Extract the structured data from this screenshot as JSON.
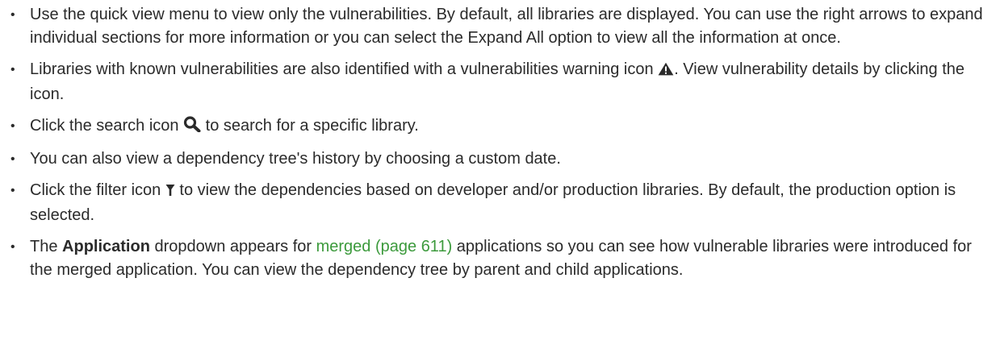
{
  "items": [
    {
      "text": "Use the quick view menu to view only the vulnerabilities. By default, all libraries are displayed. You can use the right arrows to expand individual sections for more information or you can select the Expand All option to view all the information at once."
    },
    {
      "before_icon": "Libraries with known vulnerabilities are also identified with a vulnerabilities warning icon ",
      "icon": "warning-triangle-icon",
      "after_icon": ". View vulnerability details by clicking the icon."
    },
    {
      "before_icon": "Click the search icon ",
      "icon": "search-icon",
      "after_icon": " to search for a specific library."
    },
    {
      "text": "You can also view a dependency tree's history by choosing a custom date."
    },
    {
      "before_icon": "Click the filter icon ",
      "icon": "filter-icon",
      "after_icon": " to view the dependencies based on developer and/or production libraries. By default, the production option is selected."
    },
    {
      "prefix": "The ",
      "bold": "Application",
      "middle": " dropdown appears for ",
      "link": "merged (page 611)",
      "suffix": " applications so you can see how vulnerable libraries were introduced for the merged application. You can view the dependency tree by parent and child applications."
    }
  ],
  "colors": {
    "text": "#2b2b2b",
    "link": "#3c9a3c"
  }
}
